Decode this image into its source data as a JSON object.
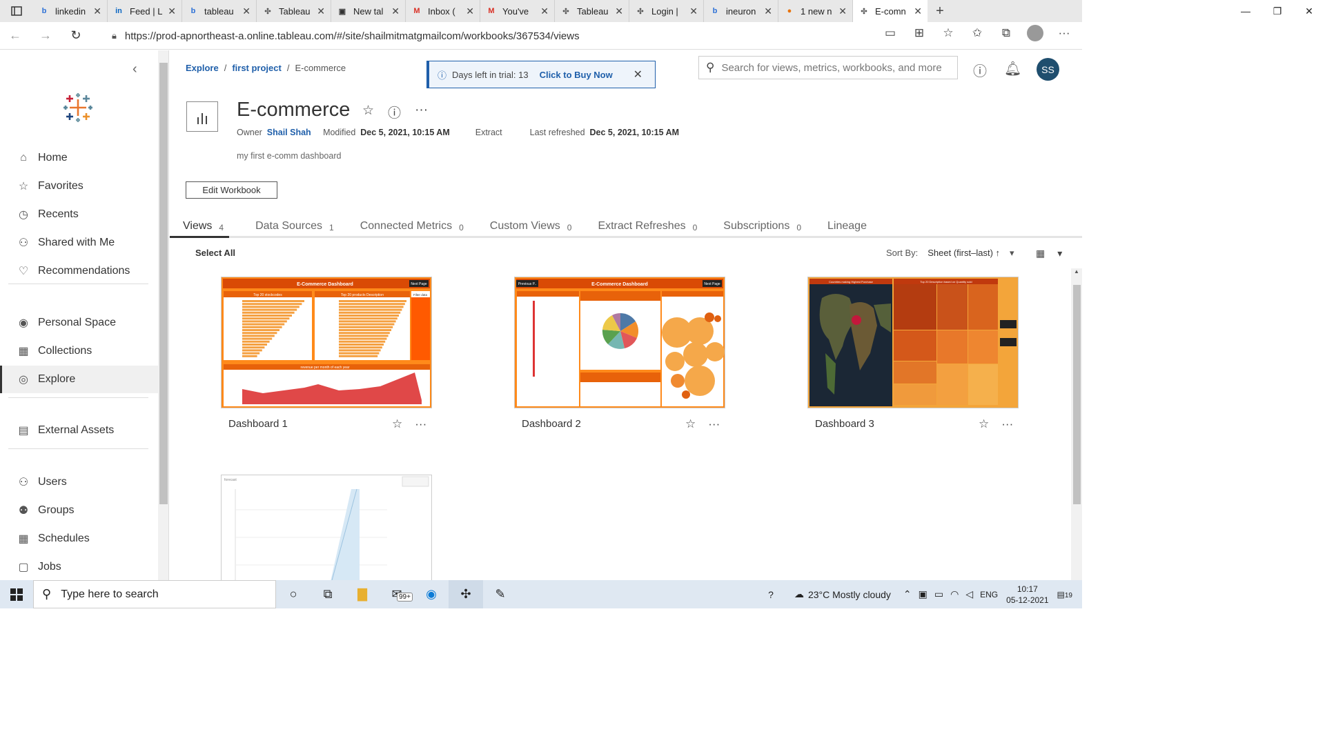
{
  "browser": {
    "tabs": [
      {
        "label": "linkedin",
        "icon": "b",
        "color": "#2b6fd6"
      },
      {
        "label": "Feed | L",
        "icon": "in",
        "color": "#0a66c2"
      },
      {
        "label": "tableau",
        "icon": "b",
        "color": "#2b6fd6"
      },
      {
        "label": "Tableau",
        "icon": "✣",
        "color": "#555"
      },
      {
        "label": "New tal",
        "icon": "▣",
        "color": "#333"
      },
      {
        "label": "Inbox (",
        "icon": "M",
        "color": "#d93025"
      },
      {
        "label": "You've",
        "icon": "M",
        "color": "#d93025"
      },
      {
        "label": "Tableau",
        "icon": "✣",
        "color": "#555"
      },
      {
        "label": "Login |",
        "icon": "✣",
        "color": "#555"
      },
      {
        "label": "ineuron",
        "icon": "b",
        "color": "#2b6fd6"
      },
      {
        "label": "1 new n",
        "icon": "●",
        "color": "#e8730c"
      },
      {
        "label": "E-comn",
        "icon": "✣",
        "color": "#555",
        "active": true
      }
    ],
    "url": "https://prod-apnortheast-a.online.tableau.com/#/site/shailmitmatgmailcom/workbooks/367534/views"
  },
  "sidebar": {
    "items": [
      {
        "label": "Home",
        "icon": "home-icon",
        "glyph": "⌂"
      },
      {
        "label": "Favorites",
        "icon": "star-icon",
        "glyph": "☆"
      },
      {
        "label": "Recents",
        "icon": "clock-icon",
        "glyph": "◷"
      },
      {
        "label": "Shared with Me",
        "icon": "shared-icon",
        "glyph": "⚇"
      },
      {
        "label": "Recommendations",
        "icon": "lightbulb-icon",
        "glyph": "♡"
      },
      {
        "label": "Personal Space",
        "icon": "person-icon",
        "glyph": "◉"
      },
      {
        "label": "Collections",
        "icon": "collections-icon",
        "glyph": "▦"
      },
      {
        "label": "Explore",
        "icon": "compass-icon",
        "glyph": "◎",
        "active": true
      },
      {
        "label": "External Assets",
        "icon": "database-icon",
        "glyph": "▤"
      },
      {
        "label": "Users",
        "icon": "user-icon",
        "glyph": "⚇"
      },
      {
        "label": "Groups",
        "icon": "group-icon",
        "glyph": "⚉"
      },
      {
        "label": "Schedules",
        "icon": "calendar-icon",
        "glyph": "▦"
      },
      {
        "label": "Jobs",
        "icon": "jobs-icon",
        "glyph": "▢"
      }
    ]
  },
  "header": {
    "breadcrumb": {
      "root": "Explore",
      "project": "first project",
      "current": "E-commerce"
    },
    "trial": {
      "text": "Days left in trial: 13",
      "buy": "Click to Buy Now"
    },
    "search_placeholder": "Search for views, metrics, workbooks, and more",
    "avatar_initials": "SS"
  },
  "workbook": {
    "title": "E-commerce",
    "owner_label": "Owner",
    "owner": "Shail Shah",
    "modified_label": "Modified",
    "modified": "Dec 5, 2021, 10:15 AM",
    "extract": "Extract",
    "refreshed_label": "Last refreshed",
    "refreshed": "Dec 5, 2021, 10:15 AM",
    "description": "my first e-comm dashboard",
    "edit_label": "Edit Workbook"
  },
  "tabs": [
    {
      "label": "Views",
      "count": "4",
      "active": true
    },
    {
      "label": "Data Sources",
      "count": "1"
    },
    {
      "label": "Connected Metrics",
      "count": "0"
    },
    {
      "label": "Custom Views",
      "count": "0"
    },
    {
      "label": "Extract Refreshes",
      "count": "0"
    },
    {
      "label": "Subscriptions",
      "count": "0"
    },
    {
      "label": "Lineage",
      "count": ""
    }
  ],
  "toolbar": {
    "select_all": "Select All",
    "sort_label": "Sort By:",
    "sort_value": "Sheet (first–last) ↑"
  },
  "views": [
    {
      "name": "Dashboard 1"
    },
    {
      "name": "Dashboard 2"
    },
    {
      "name": "Dashboard 3"
    },
    {
      "name": ""
    }
  ],
  "thumbnails": {
    "d1_title": "E-Commerce Dashboard",
    "d1_next": "Next Page",
    "d1_left": "Top 20 stockcodes",
    "d1_mid": "Top 20 products Description",
    "d1_filter": "Filter data",
    "d1_bottom": "revenue per month of each year",
    "d2_title": "E-Commerce Dashboard",
    "d2_prev": "Previous P..",
    "d2_next": "Next Page",
    "d3_left": "Countries making Highest Purchase",
    "d3_right": "Top 20 Description based on Quantity sold",
    "d4_title": "forecast"
  },
  "taskbar": {
    "search": "Type here to search",
    "mail_badge": "99+",
    "weather": "23°C  Mostly cloudy",
    "lang": "ENG",
    "time": "10:17",
    "date": "05-12-2021",
    "notif": "19"
  },
  "colors": {
    "accent": "#1f5faa",
    "dash_orange": "#ff8a1a",
    "dash_dark": "#c0390e"
  }
}
